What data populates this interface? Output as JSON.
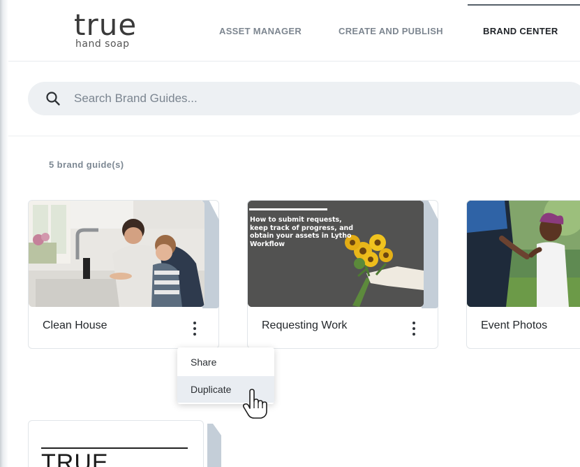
{
  "logo": {
    "main": "true",
    "sub": "hand soap"
  },
  "nav": [
    {
      "label": "ASSET MANAGER",
      "active": false
    },
    {
      "label": "CREATE AND PUBLISH",
      "active": false
    },
    {
      "label": "BRAND CENTER",
      "active": true
    }
  ],
  "search": {
    "placeholder": "Search Brand Guides...",
    "value": ""
  },
  "count_label": "5 brand guide(s)",
  "cards": [
    {
      "title": "Clean House",
      "image": "father-and-son-washing-hands-photo"
    },
    {
      "title": "Requesting Work",
      "image": "sunflower-bouquet-photo",
      "overlay_text": "How to submit requests, keep track of progress, and obtain your assets in Lytho Workflow"
    },
    {
      "title": "Event Photos",
      "image": "parent-and-child-walking-photo"
    },
    {
      "title": "",
      "image": "true-logo-document",
      "overlay_text": "TRUE"
    }
  ],
  "menu": {
    "items": [
      {
        "label": "Share",
        "hovered": false
      },
      {
        "label": "Duplicate",
        "hovered": true
      }
    ]
  },
  "colors": {
    "accent_bar": "#56606a",
    "stack": "#c4ced8",
    "search_bg": "#edf0f3"
  }
}
